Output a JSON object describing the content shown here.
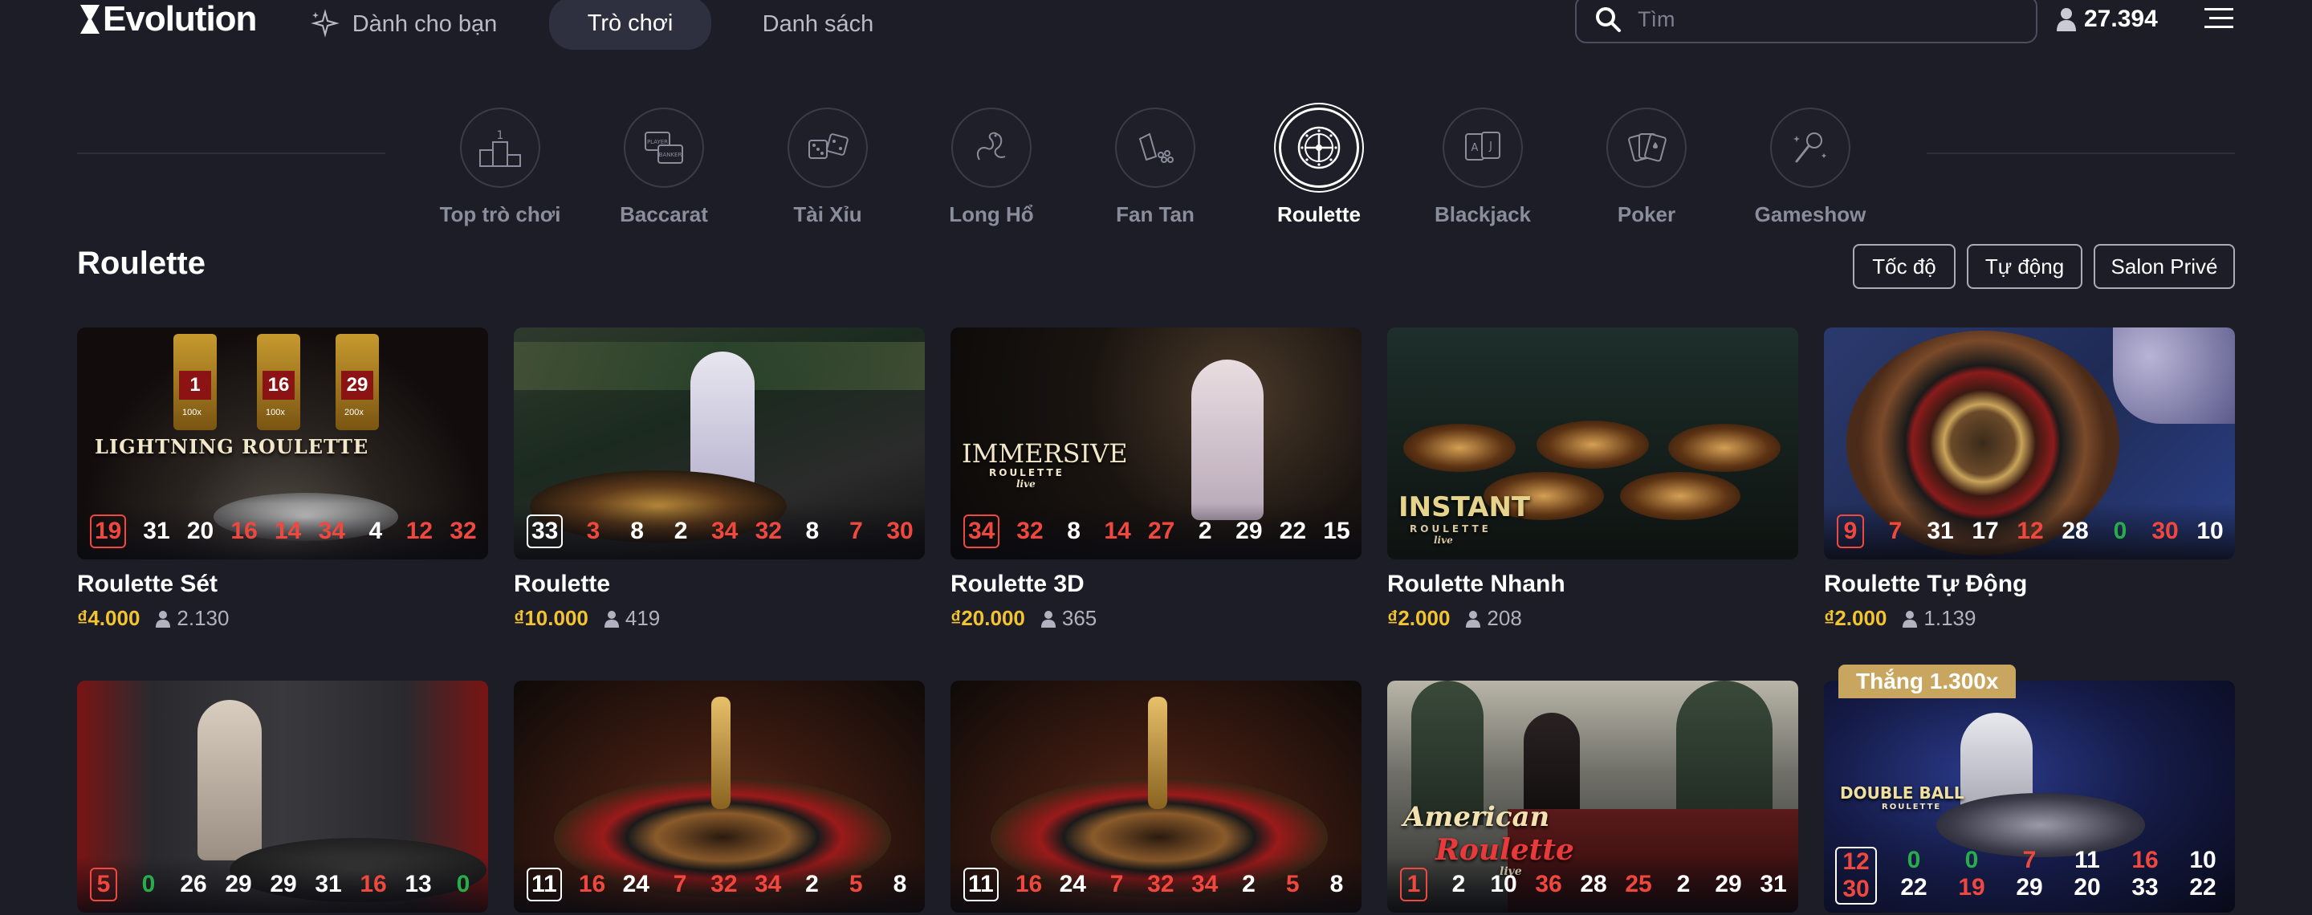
{
  "header": {
    "logo": "Evolution",
    "nav": [
      {
        "label": "Dành cho bạn",
        "icon": "sparkle-icon"
      },
      {
        "label": "Trò chơi",
        "active": true
      },
      {
        "label": "Danh sách"
      }
    ],
    "search_placeholder": "Tìm",
    "players_online": "27.394"
  },
  "categories": [
    {
      "label": "Top trò chơi",
      "icon": "podium-icon"
    },
    {
      "label": "Baccarat",
      "icon": "baccarat-icon"
    },
    {
      "label": "Tài Xỉu",
      "icon": "dice-icon"
    },
    {
      "label": "Long Hổ",
      "icon": "dragon-icon"
    },
    {
      "label": "Fan Tan",
      "icon": "fan-tan-icon"
    },
    {
      "label": "Roulette",
      "icon": "roulette-wheel-icon",
      "active": true
    },
    {
      "label": "Blackjack",
      "icon": "blackjack-cards-icon"
    },
    {
      "label": "Poker",
      "icon": "poker-cards-icon"
    },
    {
      "label": "Gameshow",
      "icon": "microphone-icon"
    }
  ],
  "section": {
    "title": "Roulette",
    "filters": [
      "Tốc độ",
      "Tự động",
      "Salon Privé"
    ]
  },
  "games": [
    {
      "title": "Roulette Sét",
      "bet": "₫4.000",
      "players": "2.130",
      "logo": "LIGHTNING ROULETTE",
      "multipliers": [
        "1",
        "16",
        "29"
      ],
      "multiplier_labels": [
        "100x",
        "100x",
        "200x"
      ],
      "numbers": [
        {
          "v": "19",
          "c": "red",
          "box": true
        },
        {
          "v": "31",
          "c": "white"
        },
        {
          "v": "20",
          "c": "white"
        },
        {
          "v": "16",
          "c": "red"
        },
        {
          "v": "14",
          "c": "red"
        },
        {
          "v": "34",
          "c": "red"
        },
        {
          "v": "4",
          "c": "white"
        },
        {
          "v": "12",
          "c": "red"
        },
        {
          "v": "32",
          "c": "red"
        }
      ]
    },
    {
      "title": "Roulette",
      "bet": "₫10.000",
      "players": "419",
      "logo": "",
      "numbers": [
        {
          "v": "33",
          "c": "white",
          "box": true
        },
        {
          "v": "3",
          "c": "red"
        },
        {
          "v": "8",
          "c": "white"
        },
        {
          "v": "2",
          "c": "white"
        },
        {
          "v": "34",
          "c": "red"
        },
        {
          "v": "32",
          "c": "red"
        },
        {
          "v": "8",
          "c": "white"
        },
        {
          "v": "7",
          "c": "red"
        },
        {
          "v": "30",
          "c": "red"
        }
      ]
    },
    {
      "title": "Roulette 3D",
      "bet": "₫20.000",
      "players": "365",
      "logo": "IMMERSIVE",
      "logo_sub": "ROULETTE",
      "logo_live": "live",
      "numbers": [
        {
          "v": "34",
          "c": "red",
          "box": true
        },
        {
          "v": "32",
          "c": "red"
        },
        {
          "v": "8",
          "c": "white"
        },
        {
          "v": "14",
          "c": "red"
        },
        {
          "v": "27",
          "c": "red"
        },
        {
          "v": "2",
          "c": "white"
        },
        {
          "v": "29",
          "c": "white"
        },
        {
          "v": "22",
          "c": "white"
        },
        {
          "v": "15",
          "c": "white"
        }
      ]
    },
    {
      "title": "Roulette Nhanh",
      "bet": "₫2.000",
      "players": "208",
      "logo": "INSTANT",
      "logo_sub": "ROULETTE",
      "logo_live": "live",
      "numbers": []
    },
    {
      "title": "Roulette Tự Động",
      "bet": "₫2.000",
      "players": "1.139",
      "logo": "",
      "numbers": [
        {
          "v": "9",
          "c": "red",
          "box": true
        },
        {
          "v": "7",
          "c": "red"
        },
        {
          "v": "31",
          "c": "white"
        },
        {
          "v": "17",
          "c": "white"
        },
        {
          "v": "12",
          "c": "red"
        },
        {
          "v": "28",
          "c": "white"
        },
        {
          "v": "0",
          "c": "green"
        },
        {
          "v": "30",
          "c": "red"
        },
        {
          "v": "10",
          "c": "white"
        }
      ]
    },
    {
      "title": "",
      "bet": "",
      "players": "",
      "logo": "",
      "numbers": [
        {
          "v": "5",
          "c": "red",
          "box": true
        },
        {
          "v": "0",
          "c": "green"
        },
        {
          "v": "26",
          "c": "white"
        },
        {
          "v": "29",
          "c": "white"
        },
        {
          "v": "29",
          "c": "white"
        },
        {
          "v": "31",
          "c": "white"
        },
        {
          "v": "16",
          "c": "red"
        },
        {
          "v": "13",
          "c": "white"
        },
        {
          "v": "0",
          "c": "green"
        }
      ]
    },
    {
      "title": "",
      "bet": "",
      "players": "",
      "logo": "",
      "numbers": [
        {
          "v": "11",
          "c": "white",
          "box": true
        },
        {
          "v": "16",
          "c": "red"
        },
        {
          "v": "24",
          "c": "white"
        },
        {
          "v": "7",
          "c": "red"
        },
        {
          "v": "32",
          "c": "red"
        },
        {
          "v": "34",
          "c": "red"
        },
        {
          "v": "2",
          "c": "white"
        },
        {
          "v": "5",
          "c": "red"
        },
        {
          "v": "8",
          "c": "white"
        }
      ]
    },
    {
      "title": "",
      "bet": "",
      "players": "",
      "logo": "",
      "numbers": [
        {
          "v": "11",
          "c": "white",
          "box": true
        },
        {
          "v": "16",
          "c": "red"
        },
        {
          "v": "24",
          "c": "white"
        },
        {
          "v": "7",
          "c": "red"
        },
        {
          "v": "32",
          "c": "red"
        },
        {
          "v": "34",
          "c": "red"
        },
        {
          "v": "2",
          "c": "white"
        },
        {
          "v": "5",
          "c": "red"
        },
        {
          "v": "8",
          "c": "white"
        }
      ]
    },
    {
      "title": "",
      "bet": "",
      "players": "",
      "logo": "American",
      "logo_sub": "Roulette",
      "logo_live": "live",
      "numbers": [
        {
          "v": "1",
          "c": "red",
          "box": true
        },
        {
          "v": "2",
          "c": "white"
        },
        {
          "v": "10",
          "c": "white"
        },
        {
          "v": "36",
          "c": "red"
        },
        {
          "v": "28",
          "c": "white"
        },
        {
          "v": "25",
          "c": "red"
        },
        {
          "v": "2",
          "c": "white"
        },
        {
          "v": "29",
          "c": "white"
        },
        {
          "v": "31",
          "c": "white"
        }
      ]
    },
    {
      "title": "",
      "bet": "",
      "players": "",
      "logo": "DOUBLE BALL",
      "logo_sub": "ROULETTE",
      "badge": "Thắng 1.300x",
      "pairs": [
        {
          "a": "12",
          "ac": "red",
          "b": "30",
          "bc": "red",
          "box": true
        },
        {
          "a": "0",
          "ac": "green",
          "b": "22",
          "bc": "white"
        },
        {
          "a": "0",
          "ac": "green",
          "b": "19",
          "bc": "red"
        },
        {
          "a": "7",
          "ac": "red",
          "b": "29",
          "bc": "white"
        },
        {
          "a": "11",
          "ac": "white",
          "b": "20",
          "bc": "white"
        },
        {
          "a": "16",
          "ac": "red",
          "b": "33",
          "bc": "white"
        },
        {
          "a": "10",
          "ac": "white",
          "b": "22",
          "bc": "white"
        }
      ]
    }
  ]
}
